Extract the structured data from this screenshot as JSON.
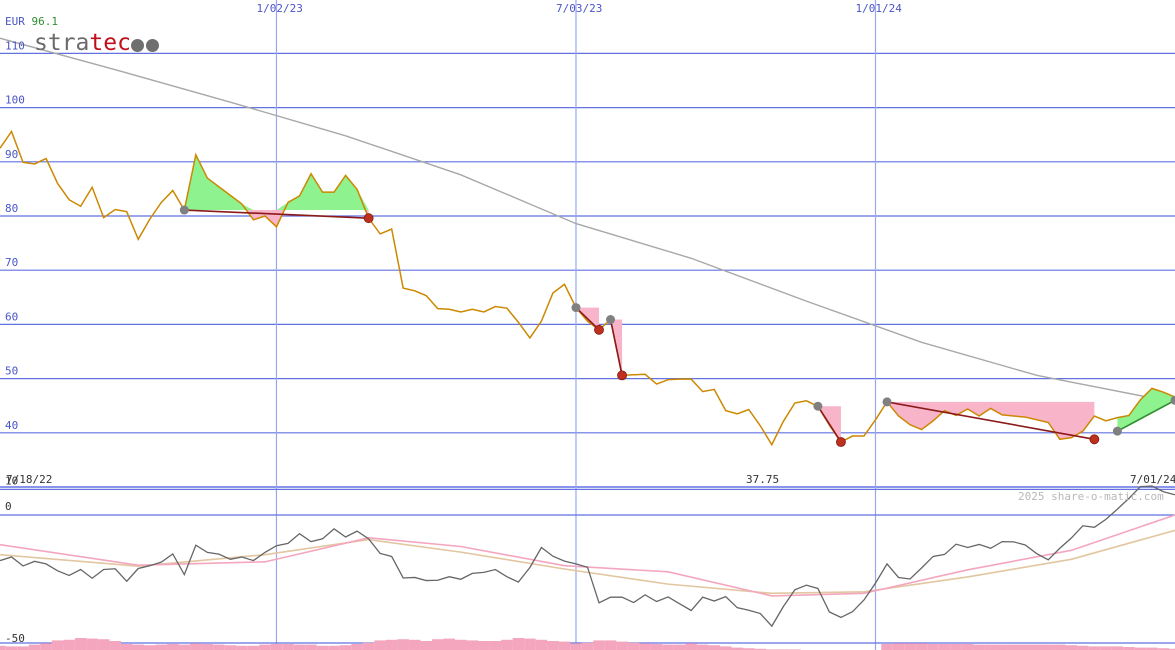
{
  "header": {
    "currency": "EUR",
    "indicator_value": "96.1",
    "logo_part1": "stra",
    "logo_part2": "tec",
    "logo_dots": "●●"
  },
  "footer": {
    "start_date": "7/18/22",
    "end_date": "7/01/24",
    "min_label": "37.75",
    "copyright": "2025 share-o-matic.com"
  },
  "colors": {
    "price": "#cc8800",
    "ma": "#a8a8a8",
    "grid_h": "#6272e0",
    "grid_v": "#9aa6ee",
    "up_fill": "#8ef28e",
    "down_fill": "#f8b4c8",
    "down_line": "#8b1a1a",
    "up_line": "#2f8f2f",
    "marker_grey": "#808080",
    "marker_red": "#c0301f",
    "osc_main": "#666666",
    "osc_pink": "#f4a6bf",
    "osc_tan": "#e2c6a0",
    "volume": "#f4a6bf"
  },
  "chart_data": [
    {
      "type": "line",
      "title": "",
      "x_axis": {
        "type": "date",
        "range": [
          "2022-07-18",
          "2024-07-01"
        ],
        "tick_labels": [
          "1/02/23",
          "7/03/23",
          "1/01/24"
        ],
        "tick_dates": [
          "2023-01-02",
          "2023-07-03",
          "2024-01-01"
        ]
      },
      "y_axis": {
        "range": [
          36,
          112
        ],
        "tick_labels": [
          "40",
          "50",
          "60",
          "70",
          "80",
          "90",
          "100",
          "110"
        ],
        "ticks": [
          40,
          50,
          60,
          70,
          80,
          90,
          100,
          110
        ]
      },
      "grid": true,
      "series": [
        {
          "role": "price",
          "dates": [
            "2022-07-18",
            "2022-07-25",
            "2022-08-01",
            "2022-08-08",
            "2022-08-15",
            "2022-08-22",
            "2022-08-29",
            "2022-09-05",
            "2022-09-12",
            "2022-09-19",
            "2022-09-26",
            "2022-10-03",
            "2022-10-10",
            "2022-10-17",
            "2022-10-24",
            "2022-10-31",
            "2022-11-07",
            "2022-11-14",
            "2022-11-21",
            "2022-11-28",
            "2022-12-05",
            "2022-12-12",
            "2022-12-19",
            "2022-12-26",
            "2023-01-02",
            "2023-01-09",
            "2023-01-16",
            "2023-01-23",
            "2023-01-30",
            "2023-02-06",
            "2023-02-13",
            "2023-02-20",
            "2023-02-27",
            "2023-03-06",
            "2023-03-13",
            "2023-03-20",
            "2023-03-27",
            "2023-04-03",
            "2023-04-10",
            "2023-04-17",
            "2023-04-24",
            "2023-05-01",
            "2023-05-08",
            "2023-05-15",
            "2023-05-22",
            "2023-05-29",
            "2023-06-05",
            "2023-06-12",
            "2023-06-19",
            "2023-06-26",
            "2023-07-03",
            "2023-07-10",
            "2023-07-17",
            "2023-07-24",
            "2023-07-31",
            "2023-08-07",
            "2023-08-14",
            "2023-08-21",
            "2023-08-28",
            "2023-09-04",
            "2023-09-11",
            "2023-09-18",
            "2023-09-25",
            "2023-10-02",
            "2023-10-09",
            "2023-10-16",
            "2023-10-23",
            "2023-10-30",
            "2023-11-06",
            "2023-11-13",
            "2023-11-20",
            "2023-11-27",
            "2023-12-04",
            "2023-12-11",
            "2023-12-18",
            "2023-12-25",
            "2024-01-01",
            "2024-01-08",
            "2024-01-15",
            "2024-01-22",
            "2024-01-29",
            "2024-02-05",
            "2024-02-12",
            "2024-02-19",
            "2024-02-26",
            "2024-03-04",
            "2024-03-11",
            "2024-03-18",
            "2024-03-25",
            "2024-04-01",
            "2024-04-08",
            "2024-04-15",
            "2024-04-22",
            "2024-04-29",
            "2024-05-06",
            "2024-05-13",
            "2024-05-20",
            "2024-05-27",
            "2024-06-03",
            "2024-06-10",
            "2024-06-17",
            "2024-06-24",
            "2024-07-01"
          ],
          "values": [
            92.5,
            95.6,
            89.9,
            89.6,
            90.6,
            86.0,
            83.0,
            81.8,
            85.3,
            79.7,
            81.2,
            80.8,
            75.7,
            79.4,
            82.5,
            84.7,
            81.1,
            91.3,
            87.0,
            85.4,
            83.8,
            82.2,
            79.3,
            80.0,
            78.0,
            82.5,
            83.7,
            87.8,
            84.4,
            84.4,
            87.5,
            84.9,
            79.6,
            76.7,
            77.6,
            66.7,
            66.2,
            65.3,
            62.9,
            62.8,
            62.3,
            62.8,
            62.3,
            63.3,
            63.0,
            60.4,
            57.5,
            60.6,
            65.8,
            67.4,
            63.1,
            60.6,
            59.0,
            60.9,
            50.6,
            50.7,
            50.8,
            49.0,
            49.8,
            49.9,
            49.9,
            47.6,
            48.0,
            44.1,
            43.5,
            44.3,
            41.3,
            37.8,
            42.1,
            45.5,
            45.9,
            44.9,
            41.4,
            38.3,
            39.4,
            39.4,
            42.4,
            45.7,
            43.1,
            41.5,
            40.6,
            42.2,
            44.1,
            43.2,
            44.4,
            43.1,
            44.5,
            43.3,
            43.1,
            42.9,
            42.4,
            41.9,
            38.8,
            39.1,
            40.3,
            43.1,
            42.2,
            42.8,
            43.2,
            46.1,
            48.2,
            47.5,
            46.6
          ]
        },
        {
          "role": "moving-average",
          "dates": [
            "2022-07-18",
            "2022-09-26",
            "2022-12-05",
            "2023-02-13",
            "2023-04-24",
            "2023-07-03",
            "2023-09-11",
            "2023-11-20",
            "2024-01-29",
            "2024-04-08",
            "2024-07-01"
          ],
          "values": [
            112.8,
            107.0,
            101.0,
            94.8,
            87.6,
            78.6,
            72.2,
            64.3,
            56.7,
            50.6,
            45.6
          ]
        }
      ],
      "signals": [
        {
          "kind": "down",
          "from": {
            "date": "2022-11-07",
            "value": 81.1
          },
          "to": {
            "date": "2023-02-27",
            "value": 79.6
          }
        },
        {
          "kind": "down",
          "from": {
            "date": "2023-07-03",
            "value": 63.1
          },
          "to": {
            "date": "2023-07-17",
            "value": 59.0
          }
        },
        {
          "kind": "down",
          "from": {
            "date": "2023-07-24",
            "value": 60.9
          },
          "to": {
            "date": "2023-07-31",
            "value": 50.6
          }
        },
        {
          "kind": "down",
          "from": {
            "date": "2023-11-27",
            "value": 44.9
          },
          "to": {
            "date": "2023-12-11",
            "value": 38.3
          }
        },
        {
          "kind": "down",
          "from": {
            "date": "2024-01-08",
            "value": 45.7
          },
          "to": {
            "date": "2024-05-13",
            "value": 38.8
          }
        },
        {
          "kind": "up",
          "from": {
            "date": "2024-05-27",
            "value": 40.3
          },
          "to": {
            "date": "2024-07-01",
            "value": 46.0
          }
        }
      ]
    },
    {
      "type": "line",
      "title": "",
      "y_axis": {
        "range": [
          -50,
          10
        ],
        "tick_labels": [
          "10",
          "0",
          "-50"
        ],
        "ticks": [
          10,
          0,
          -50
        ]
      },
      "series": [
        {
          "role": "oscillator",
          "dates": [
            "2022-07-18",
            "2022-07-25",
            "2022-08-01",
            "2022-08-08",
            "2022-08-15",
            "2022-08-22",
            "2022-08-29",
            "2022-09-05",
            "2022-09-12",
            "2022-09-19",
            "2022-09-26",
            "2022-10-03",
            "2022-10-10",
            "2022-10-17",
            "2022-10-24",
            "2022-10-31",
            "2022-11-07",
            "2022-11-14",
            "2022-11-21",
            "2022-11-28",
            "2022-12-05",
            "2022-12-12",
            "2022-12-19",
            "2022-12-26",
            "2023-01-02",
            "2023-01-09",
            "2023-01-16",
            "2023-01-23",
            "2023-01-30",
            "2023-02-06",
            "2023-02-13",
            "2023-02-20",
            "2023-02-27",
            "2023-03-06",
            "2023-03-13",
            "2023-03-20",
            "2023-03-27",
            "2023-04-03",
            "2023-04-10",
            "2023-04-17",
            "2023-04-24",
            "2023-05-01",
            "2023-05-08",
            "2023-05-15",
            "2023-05-22",
            "2023-05-29",
            "2023-06-05",
            "2023-06-12",
            "2023-06-19",
            "2023-06-26",
            "2023-07-03",
            "2023-07-10",
            "2023-07-17",
            "2023-07-24",
            "2023-07-31",
            "2023-08-07",
            "2023-08-14",
            "2023-08-21",
            "2023-08-28",
            "2023-09-04",
            "2023-09-11",
            "2023-09-18",
            "2023-09-25",
            "2023-10-02",
            "2023-10-09",
            "2023-10-16",
            "2023-10-23",
            "2023-10-30",
            "2023-11-06",
            "2023-11-13",
            "2023-11-20",
            "2023-11-27",
            "2023-12-04",
            "2023-12-11",
            "2023-12-18",
            "2023-12-25",
            "2024-01-01",
            "2024-01-08",
            "2024-01-15",
            "2024-01-22",
            "2024-01-29",
            "2024-02-05",
            "2024-02-12",
            "2024-02-19",
            "2024-02-26",
            "2024-03-04",
            "2024-03-11",
            "2024-03-18",
            "2024-03-25",
            "2024-04-01",
            "2024-04-08",
            "2024-04-15",
            "2024-04-22",
            "2024-04-29",
            "2024-05-06",
            "2024-05-13",
            "2024-05-20",
            "2024-05-27",
            "2024-06-03",
            "2024-06-10",
            "2024-06-17",
            "2024-06-24",
            "2024-07-01"
          ],
          "values": [
            -17.8,
            -16.4,
            -19.9,
            -18.1,
            -19.1,
            -21.8,
            -23.6,
            -21.3,
            -24.7,
            -21.3,
            -21.0,
            -25.9,
            -20.9,
            -19.8,
            -18.4,
            -15.2,
            -23.3,
            -11.8,
            -14.6,
            -15.3,
            -17.3,
            -16.4,
            -17.8,
            -14.6,
            -12.0,
            -11.1,
            -7.3,
            -10.4,
            -9.3,
            -5.4,
            -8.6,
            -6.3,
            -9.3,
            -15.0,
            -16.2,
            -24.6,
            -24.4,
            -25.6,
            -25.5,
            -24.1,
            -25.1,
            -22.8,
            -22.4,
            -21.3,
            -24.1,
            -26.2,
            -20.5,
            -12.7,
            -16.1,
            -18.0,
            -19.1,
            -20.4,
            -34.3,
            -32.1,
            -32.1,
            -34.2,
            -31.2,
            -33.8,
            -32.0,
            -34.7,
            -37.3,
            -32.1,
            -33.6,
            -31.9,
            -36.2,
            -37.2,
            -38.5,
            -43.4,
            -35.8,
            -29.2,
            -27.4,
            -28.7,
            -37.9,
            -40.0,
            -37.8,
            -33.2,
            -26.6,
            -19.1,
            -24.4,
            -25.0,
            -20.7,
            -16.2,
            -15.4,
            -11.4,
            -12.7,
            -11.5,
            -13.0,
            -10.4,
            -10.5,
            -11.7,
            -15.1,
            -17.5,
            -13.0,
            -9.0,
            -4.2,
            -4.8,
            -1.7,
            2.3,
            6.5,
            11.1,
            11.3,
            9.1,
            7.9
          ]
        },
        {
          "role": "signal-fast",
          "dates": [
            "2022-07-18",
            "2022-10-10",
            "2022-12-26",
            "2023-02-27",
            "2023-04-24",
            "2023-06-26",
            "2023-08-28",
            "2023-10-30",
            "2023-12-25",
            "2024-02-26",
            "2024-04-29",
            "2024-07-01"
          ],
          "values": [
            -11.6,
            -19.6,
            -18.3,
            -8.9,
            -12.3,
            -19.8,
            -22.2,
            -31.6,
            -30.6,
            -21.4,
            -13.8,
            0.0
          ]
        },
        {
          "role": "signal-slow",
          "dates": [
            "2022-07-18",
            "2022-10-10",
            "2022-12-26",
            "2023-02-27",
            "2023-04-24",
            "2023-06-26",
            "2023-08-28",
            "2023-10-30",
            "2023-12-25",
            "2024-02-26",
            "2024-04-29",
            "2024-07-01"
          ],
          "values": [
            -15.5,
            -20.0,
            -15.5,
            -9.6,
            -14.5,
            -21.1,
            -27.0,
            -30.6,
            -30.0,
            -24.2,
            -17.3,
            -6.0
          ]
        }
      ],
      "volume": {
        "dates": [
          "2022-07-18",
          "2022-07-25",
          "2022-08-01",
          "2022-08-08",
          "2022-08-15",
          "2022-08-22",
          "2022-08-29",
          "2022-09-05",
          "2022-09-12",
          "2022-09-19",
          "2022-09-26",
          "2022-10-03",
          "2022-10-10",
          "2022-10-17",
          "2022-10-24",
          "2022-10-31",
          "2022-11-07",
          "2022-11-14",
          "2022-11-21",
          "2022-11-28",
          "2022-12-05",
          "2022-12-12",
          "2022-12-19",
          "2022-12-26",
          "2023-01-02",
          "2023-01-09",
          "2023-01-16",
          "2023-01-23",
          "2023-01-30",
          "2023-02-06",
          "2023-02-13",
          "2023-02-20",
          "2023-02-27",
          "2023-03-06",
          "2023-03-13",
          "2023-03-20",
          "2023-03-27",
          "2023-04-03",
          "2023-04-10",
          "2023-04-17",
          "2023-04-24",
          "2023-05-01",
          "2023-05-08",
          "2023-05-15",
          "2023-05-22",
          "2023-05-29",
          "2023-06-05",
          "2023-06-12",
          "2023-06-19",
          "2023-06-26",
          "2023-07-03",
          "2023-07-10",
          "2023-07-17",
          "2023-07-24",
          "2023-07-31",
          "2023-08-07",
          "2023-08-14",
          "2023-08-21",
          "2023-08-28",
          "2023-09-04",
          "2023-09-11",
          "2023-09-18",
          "2023-09-25",
          "2023-10-02",
          "2023-10-09",
          "2023-10-16",
          "2023-10-23",
          "2023-10-30",
          "2023-11-06",
          "2023-11-13",
          "2023-11-20",
          "2023-11-27",
          "2023-12-04",
          "2023-12-11",
          "2023-12-18",
          "2023-12-25",
          "2024-01-01",
          "2024-01-08",
          "2024-01-15",
          "2024-01-22",
          "2024-01-29",
          "2024-02-05",
          "2024-02-12",
          "2024-02-19",
          "2024-02-26",
          "2024-03-04",
          "2024-03-11",
          "2024-03-18",
          "2024-03-25",
          "2024-04-01",
          "2024-04-08",
          "2024-04-15",
          "2024-04-22",
          "2024-04-29",
          "2024-05-06",
          "2024-05-13",
          "2024-05-20",
          "2024-05-27",
          "2024-06-03",
          "2024-06-10",
          "2024-06-17",
          "2024-06-24",
          "2024-07-01"
        ],
        "values": [
          0.35,
          0.3,
          0.3,
          0.45,
          0.55,
          0.8,
          0.85,
          1.0,
          0.95,
          0.9,
          0.75,
          0.5,
          0.45,
          0.4,
          0.45,
          0.5,
          0.45,
          0.55,
          0.5,
          0.45,
          0.4,
          0.35,
          0.35,
          0.45,
          0.5,
          0.5,
          0.45,
          0.45,
          0.35,
          0.35,
          0.4,
          0.5,
          0.6,
          0.8,
          0.85,
          0.9,
          0.85,
          0.75,
          0.9,
          0.95,
          0.85,
          0.8,
          0.75,
          0.75,
          0.85,
          1.0,
          0.95,
          0.85,
          0.75,
          0.7,
          0.55,
          0.6,
          0.8,
          0.8,
          0.7,
          0.6,
          0.55,
          0.5,
          0.45,
          0.45,
          0.55,
          0.45,
          0.4,
          0.3,
          0.2,
          0.15,
          0.1,
          0.05,
          0.05,
          0.05,
          0.0,
          0.0,
          0.0,
          0.0,
          0.0,
          0.0,
          0.0,
          0.5,
          0.55,
          0.55,
          0.55,
          0.5,
          0.5,
          0.5,
          0.5,
          0.45,
          0.45,
          0.45,
          0.45,
          0.45,
          0.45,
          0.45,
          0.45,
          0.4,
          0.35,
          0.3,
          0.3,
          0.3,
          0.25,
          0.2,
          0.2,
          0.15,
          0.1
        ]
      }
    }
  ]
}
